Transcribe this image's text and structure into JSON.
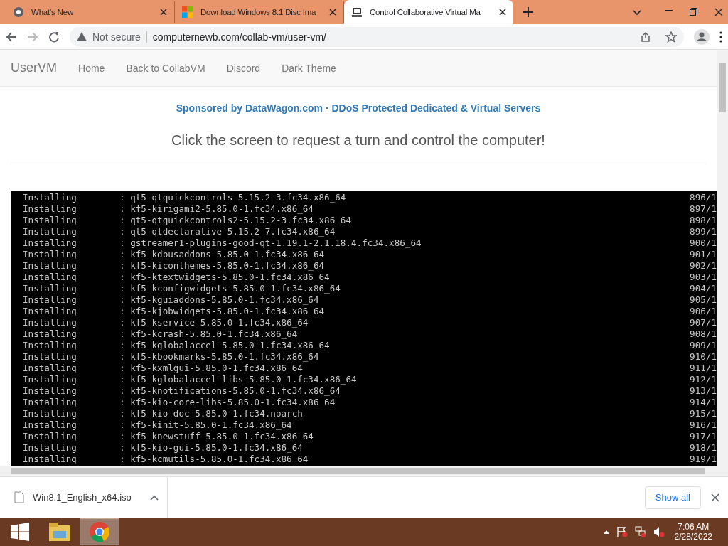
{
  "tabs": [
    {
      "title": "What's New",
      "kind": "chrome",
      "selected": false
    },
    {
      "title": "Download Windows 8.1 Disc Ima",
      "kind": "windows",
      "selected": false
    },
    {
      "title": "Control Collaborative Virtual Ma",
      "kind": "vm",
      "selected": true
    }
  ],
  "address": {
    "security": "Not secure",
    "url": "computernewb.com/collab-vm/user-vm/"
  },
  "navbar": {
    "brand": "UserVM",
    "links": [
      "Home",
      "Back to CollabVM",
      "Discord",
      "Dark Theme"
    ]
  },
  "sponsor": "Sponsored by DataWagon.com · DDoS Protected Dedicated & Virtual Servers",
  "heading": "Click the screen to request a turn and control the computer!",
  "console": {
    "lines": [
      {
        "action": "Installing",
        "package": ": qt5-qtquickcontrols-5.15.2-3.fc34.x86_64",
        "count": "896/1"
      },
      {
        "action": "Installing",
        "package": ": kf5-kirigami2-5.85.0-1.fc34.x86_64",
        "count": "897/1"
      },
      {
        "action": "Installing",
        "package": ": qt5-qtquickcontrols2-5.15.2-3.fc34.x86_64",
        "count": "898/1"
      },
      {
        "action": "Installing",
        "package": ": qt5-qtdeclarative-5.15.2-7.fc34.x86_64",
        "count": "899/1"
      },
      {
        "action": "Installing",
        "package": ": gstreamer1-plugins-good-qt-1.19.1-2.1.18.4.fc34.x86_64",
        "count": "900/1"
      },
      {
        "action": "Installing",
        "package": ": kf5-kdbusaddons-5.85.0-1.fc34.x86_64",
        "count": "901/1"
      },
      {
        "action": "Installing",
        "package": ": kf5-kiconthemes-5.85.0-1.fc34.x86_64",
        "count": "902/1"
      },
      {
        "action": "Installing",
        "package": ": kf5-ktextwidgets-5.85.0-1.fc34.x86_64",
        "count": "903/1"
      },
      {
        "action": "Installing",
        "package": ": kf5-kconfigwidgets-5.85.0-1.fc34.x86_64",
        "count": "904/1"
      },
      {
        "action": "Installing",
        "package": ": kf5-kguiaddons-5.85.0-1.fc34.x86_64",
        "count": "905/1"
      },
      {
        "action": "Installing",
        "package": ": kf5-kjobwidgets-5.85.0-1.fc34.x86_64",
        "count": "906/1"
      },
      {
        "action": "Installing",
        "package": ": kf5-kservice-5.85.0-1.fc34.x86_64",
        "count": "907/1"
      },
      {
        "action": "Installing",
        "package": ": kf5-kcrash-5.85.0-1.fc34.x86_64",
        "count": "908/1"
      },
      {
        "action": "Installing",
        "package": ": kf5-kglobalaccel-5.85.0-1.fc34.x86_64",
        "count": "909/1"
      },
      {
        "action": "Installing",
        "package": ": kf5-kbookmarks-5.85.0-1.fc34.x86_64",
        "count": "910/1"
      },
      {
        "action": "Installing",
        "package": ": kf5-kxmlgui-5.85.0-1.fc34.x86_64",
        "count": "911/1"
      },
      {
        "action": "Installing",
        "package": ": kf5-kglobalaccel-libs-5.85.0-1.fc34.x86_64",
        "count": "912/1"
      },
      {
        "action": "Installing",
        "package": ": kf5-knotifications-5.85.0-1.fc34.x86_64",
        "count": "913/1"
      },
      {
        "action": "Installing",
        "package": ": kf5-kio-core-libs-5.85.0-1.fc34.x86_64",
        "count": "914/1"
      },
      {
        "action": "Installing",
        "package": ": kf5-kio-doc-5.85.0-1.fc34.noarch",
        "count": "915/1"
      },
      {
        "action": "Installing",
        "package": ": kf5-kinit-5.85.0-1.fc34.x86_64",
        "count": "916/1"
      },
      {
        "action": "Installing",
        "package": ": kf5-knewstuff-5.85.0-1.fc34.x86_64",
        "count": "917/1"
      },
      {
        "action": "Installing",
        "package": ": kf5-kio-gui-5.85.0-1.fc34.x86_64",
        "count": "918/1"
      },
      {
        "action": "Installing",
        "package": ": kf5-kcmutils-5.85.0-1.fc34.x86_64",
        "count": "919/1"
      }
    ]
  },
  "download": {
    "filename": "Win8.1_English_x64.iso",
    "show_all": "Show all"
  },
  "taskbar": {
    "time": "7:06 AM",
    "date": "2/28/2022"
  }
}
